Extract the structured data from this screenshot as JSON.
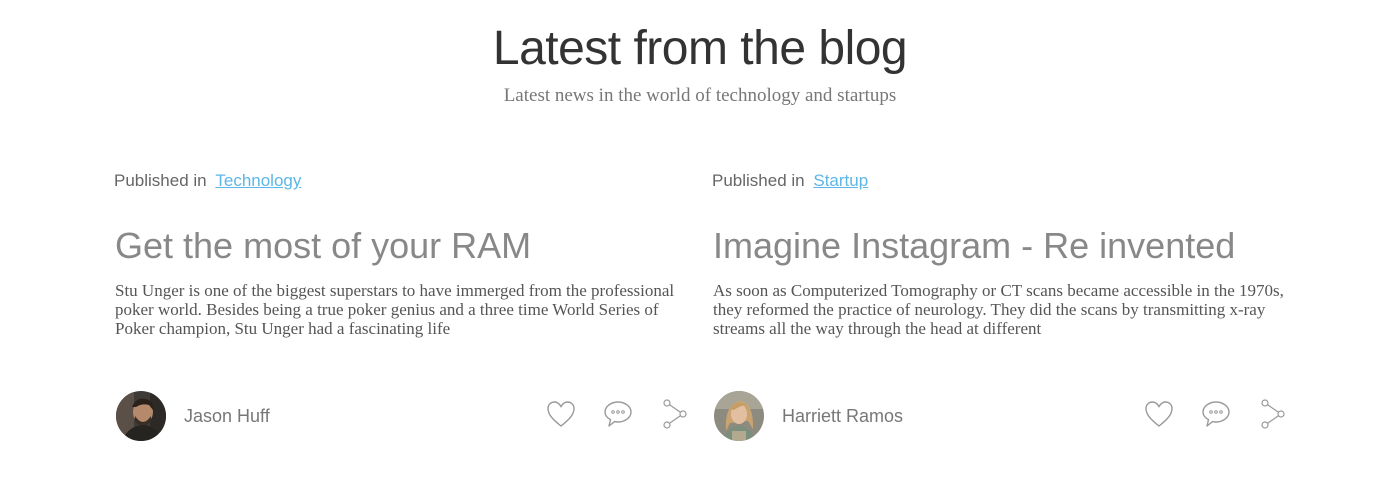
{
  "header": {
    "title": "Latest from the blog",
    "subtitle": "Latest news in the world of technology and startups"
  },
  "posts": [
    {
      "published_prefix": "Published in",
      "category": "Technology",
      "title": "Get the most of your RAM",
      "excerpt": "Stu Unger is one of the biggest superstars to have immerged from the professional poker world. Besides being a true poker genius and a three time World Series of Poker champion, Stu Unger had a fascinating life",
      "author": "Jason Huff",
      "avatar_icon": "avatar-man-photo",
      "actions": [
        "heart-icon",
        "comment-icon",
        "share-icon"
      ]
    },
    {
      "published_prefix": "Published in",
      "category": "Startup",
      "title": "Imagine Instagram - Re invented",
      "excerpt": "As soon as Computerized Tomography or CT scans became accessible in the 1970s, they reformed the practice of neurology. They did the scans by transmitting x-ray streams all the way through the head at different",
      "author": "Harriett Ramos",
      "avatar_icon": "avatar-woman-photo",
      "actions": [
        "heart-icon",
        "comment-icon",
        "share-icon"
      ]
    }
  ],
  "colors": {
    "link": "#5bb7e8",
    "title": "#333333",
    "post_title": "#888888",
    "icon": "#999999"
  }
}
